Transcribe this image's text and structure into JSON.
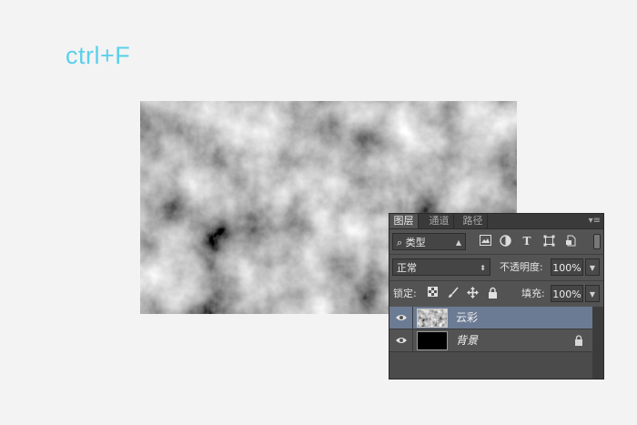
{
  "caption": "ctrl+F",
  "layers_panel": {
    "tabs": [
      {
        "label": "图层",
        "active": true
      },
      {
        "label": "通道",
        "active": false
      },
      {
        "label": "路径",
        "active": false
      }
    ],
    "panel_menu_icon": "panel-menu-icon",
    "filter": {
      "search_glyph": "⌕",
      "kind": "类型"
    },
    "filter_icons": [
      "image-filter-icon",
      "adjustment-filter-icon",
      "type-filter-icon",
      "shape-filter-icon",
      "smart-object-filter-icon"
    ],
    "blend_mode": "正常",
    "opacity_label": "不透明度:",
    "opacity_value": "100%",
    "lock_label": "锁定:",
    "lock_icons": [
      "lock-transparent-icon",
      "lock-image-icon",
      "lock-position-icon",
      "lock-all-icon"
    ],
    "fill_label": "填充:",
    "fill_value": "100%",
    "layers": [
      {
        "name": "云彩",
        "selected": true,
        "visible": true,
        "italic": false,
        "locked": false
      },
      {
        "name": "背景",
        "selected": false,
        "visible": true,
        "italic": true,
        "locked": true
      }
    ]
  },
  "colors": {
    "caption": "#5bd0ea",
    "panel_bg": "#535353",
    "selected_layer": "#6c7b94"
  }
}
